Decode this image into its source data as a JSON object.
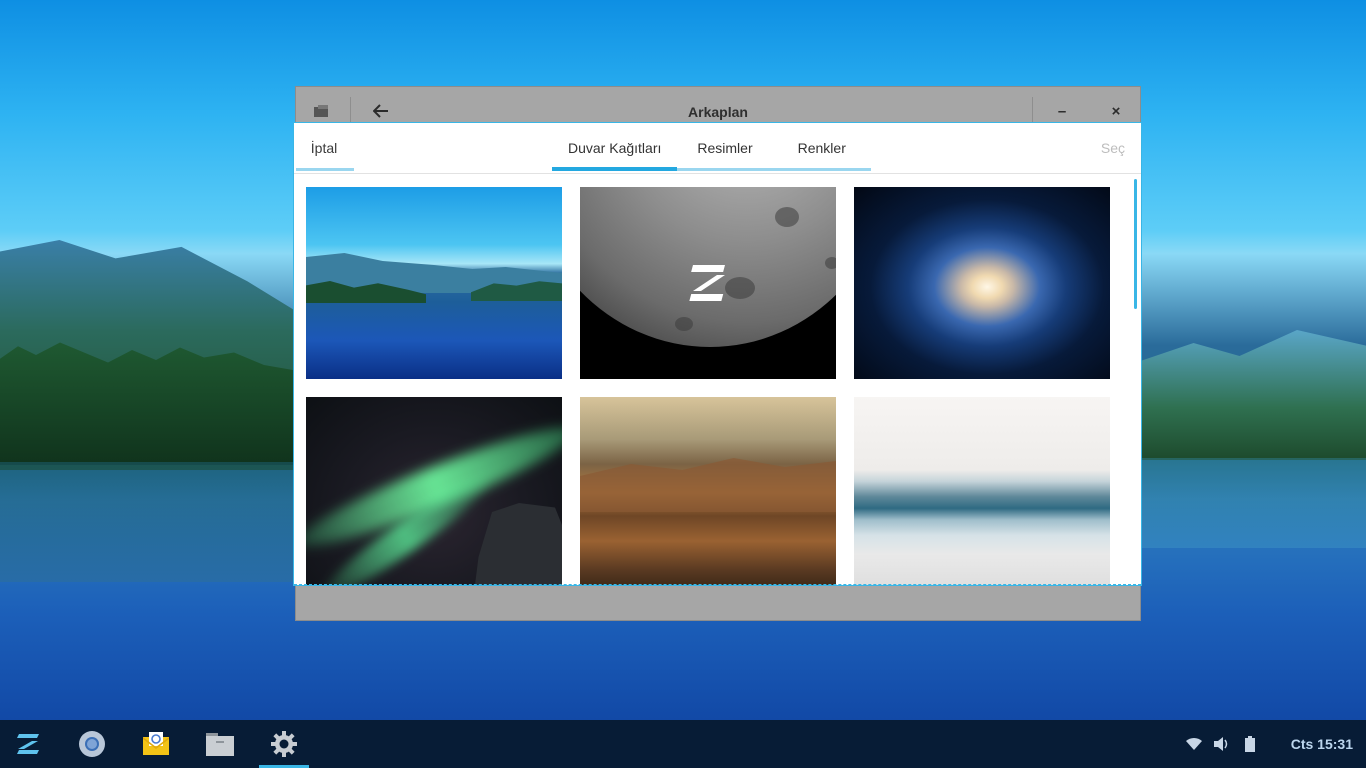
{
  "window": {
    "title": "Arkaplan",
    "back_icon": "arrow-left-icon",
    "minimize_label": "–",
    "close_label": "×"
  },
  "header": {
    "cancel_label": "İptal",
    "select_label": "Seç",
    "tabs": [
      {
        "label": "Duvar Kağıtları",
        "active": true
      },
      {
        "label": "Resimler",
        "active": false
      },
      {
        "label": "Renkler",
        "active": false
      }
    ]
  },
  "wallpapers": [
    {
      "name": "lake"
    },
    {
      "name": "moon"
    },
    {
      "name": "galaxy"
    },
    {
      "name": "aurora"
    },
    {
      "name": "canyon"
    },
    {
      "name": "sea"
    }
  ],
  "taskbar": {
    "apps": [
      "zorin-menu-icon",
      "chromium-icon",
      "mail-icon",
      "files-icon",
      "settings-icon"
    ],
    "active_app": "settings-icon",
    "tray": [
      "wifi-icon",
      "volume-icon",
      "battery-icon"
    ],
    "clock": "Cts 15:31"
  },
  "colors": {
    "accent": "#23a8e0",
    "taskbar": "#071c36"
  }
}
